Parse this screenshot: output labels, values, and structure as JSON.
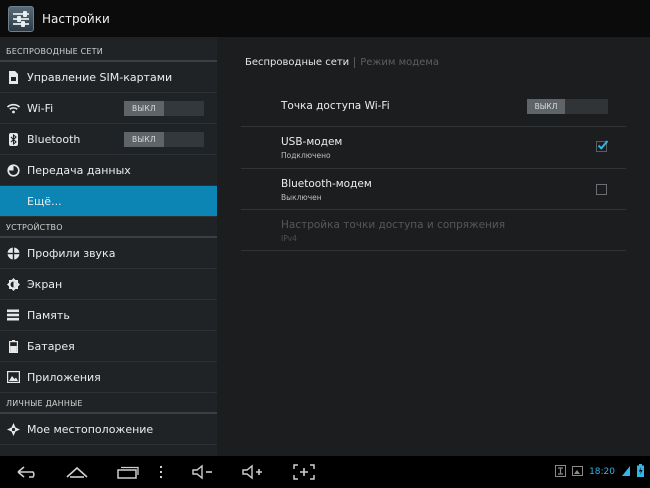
{
  "app": {
    "title": "Настройки"
  },
  "sidebar": {
    "sections": [
      {
        "header": "БЕСПРОВОДНЫЕ СЕТИ"
      },
      {
        "header": "УСТРОЙСТВО"
      },
      {
        "header": "ЛИЧНЫЕ ДАННЫЕ"
      }
    ],
    "wireless_items": [
      {
        "label": "Управление SIM-картами",
        "icon": "sim-icon"
      },
      {
        "label": "Wi-Fi",
        "icon": "wifi-icon",
        "toggle": "ВЫКЛ"
      },
      {
        "label": "Bluetooth",
        "icon": "bluetooth-icon",
        "toggle": "ВЫКЛ"
      },
      {
        "label": "Передача данных",
        "icon": "data-usage-icon"
      },
      {
        "label": "Ещё...",
        "selected": true
      }
    ],
    "device_items": [
      {
        "label": "Профили звука",
        "icon": "sound-icon"
      },
      {
        "label": "Экран",
        "icon": "display-icon"
      },
      {
        "label": "Память",
        "icon": "storage-icon"
      },
      {
        "label": "Батарея",
        "icon": "battery-icon"
      },
      {
        "label": "Приложения",
        "icon": "apps-icon"
      }
    ],
    "personal_items": [
      {
        "label": "Мое местоположение",
        "icon": "location-icon"
      }
    ]
  },
  "detail": {
    "breadcrumb": {
      "current": "Беспроводные сети",
      "other": "Режим модема"
    },
    "rows": [
      {
        "title": "Точка доступа Wi-Fi",
        "toggle": "ВЫКЛ"
      },
      {
        "title": "USB-модем",
        "subtitle": "Подключено",
        "checked": true
      },
      {
        "title": "Bluetooth-модем",
        "subtitle": "Выключен",
        "checked": false
      },
      {
        "title": "Настройка точки доступа и сопряжения",
        "subtitle": "IPv4",
        "disabled": true
      }
    ]
  },
  "navbar": {
    "buttons": [
      "back-icon",
      "home-icon",
      "recent-apps-icon",
      "menu-icon",
      "volume-down-icon",
      "volume-up-icon",
      "screenshot-icon"
    ]
  },
  "statusbar": {
    "time": "18:20"
  },
  "colors": {
    "accent": "#0c84b4",
    "holo_blue": "#33b5e5"
  }
}
